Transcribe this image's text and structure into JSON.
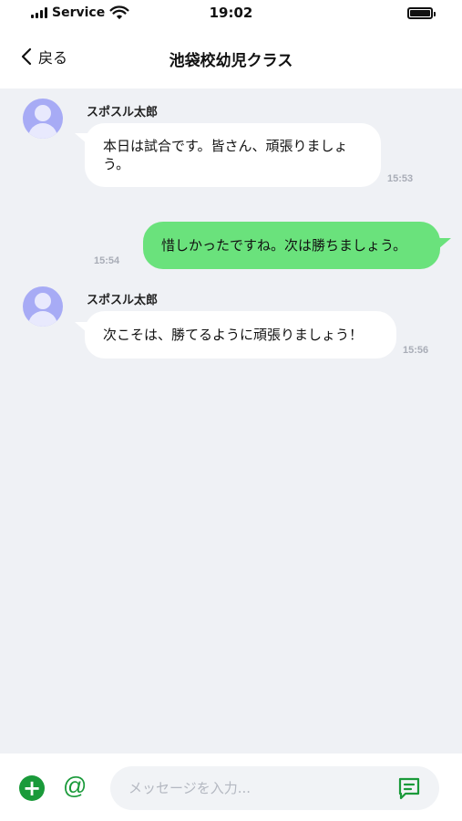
{
  "status_bar": {
    "carrier": "Service",
    "time": "19:02"
  },
  "header": {
    "back_label": "戻る",
    "title": "池袋校幼児クラス"
  },
  "messages": [
    {
      "direction": "incoming",
      "sender": "スポスル太郎",
      "lines": [
        "本日は試合です。皆さん、頑張りましょ",
        "う。"
      ],
      "time": "15:53"
    },
    {
      "direction": "outgoing",
      "text": "惜しかったですね。次は勝ちましょう。",
      "time": "15:54"
    },
    {
      "direction": "incoming",
      "sender": "スポスル太郎",
      "text": "次こそは、勝てるように頑張りましょう！",
      "time": "15:56"
    }
  ],
  "composer": {
    "add_symbol": "+",
    "mention_symbol": "@",
    "placeholder": "メッセージを入力..."
  },
  "colors": {
    "accent": "#1a9a3a",
    "outgoing_bubble": "#6ae27c",
    "avatar": "#a7abf5",
    "chat_bg": "#eff1f5"
  },
  "icons": {
    "back": "chevron-left-icon",
    "wifi": "wifi-icon",
    "battery": "battery-icon",
    "add": "plus-circle-icon",
    "mention": "at-icon",
    "send": "chat-bubble-icon"
  }
}
